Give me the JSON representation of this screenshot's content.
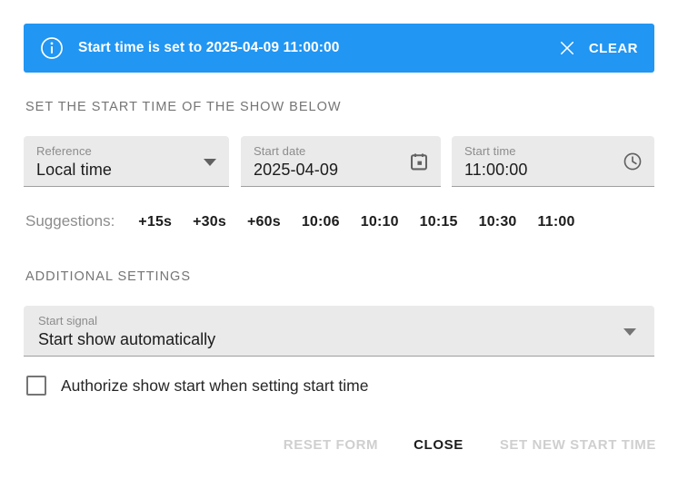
{
  "banner": {
    "icon": "info-circle-icon",
    "message_prefix": "Start time is set to ",
    "message_value": "2025-04-09 11:00:00",
    "close_icon": "close-x-icon",
    "clear_label": "CLEAR",
    "background_color": "#2196f3",
    "text_color": "#ffffff"
  },
  "sections": {
    "start_time_heading": "SET THE START TIME OF THE SHOW BELOW",
    "additional_heading": "ADDITIONAL SETTINGS"
  },
  "fields": {
    "reference": {
      "label": "Reference",
      "value": "Local time",
      "icon": "chevron-down-icon"
    },
    "start_date": {
      "label": "Start date",
      "value": "2025-04-09",
      "icon": "calendar-icon"
    },
    "start_time": {
      "label": "Start time",
      "value": "11:00:00",
      "icon": "clock-icon"
    }
  },
  "suggestions": {
    "label": "Suggestions:",
    "items": [
      {
        "label": "+15s"
      },
      {
        "label": "+30s"
      },
      {
        "label": "+60s"
      },
      {
        "label": "10:06"
      },
      {
        "label": "10:10"
      },
      {
        "label": "10:15"
      },
      {
        "label": "10:30"
      },
      {
        "label": "11:00"
      }
    ]
  },
  "start_signal": {
    "label": "Start signal",
    "value": "Start show automatically",
    "icon": "chevron-down-icon"
  },
  "authorize_checkbox": {
    "label": "Authorize show start when setting start time",
    "checked": false
  },
  "footer": {
    "reset_label": "RESET FORM",
    "reset_enabled": false,
    "close_label": "CLOSE",
    "close_enabled": true,
    "submit_label": "SET NEW START TIME",
    "submit_enabled": false
  }
}
